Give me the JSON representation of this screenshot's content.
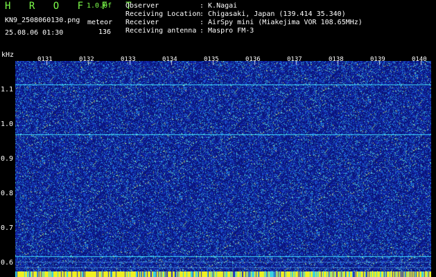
{
  "header": {
    "logo": "H R O F F T",
    "version": "1.0.0f",
    "filename": "KN9_2508060130.png",
    "datetime": "25.08.06 01:30",
    "meteor_label": "meteor",
    "meteor_count": "136"
  },
  "info": [
    {
      "key": "Observer",
      "value": ": K.Nagai"
    },
    {
      "key": "Receiving Location",
      "value": ": Chigasaki, Japan (139.414 35.340)"
    },
    {
      "key": "Receiver",
      "value": ": AirSpy mini (Miakejima VOR 108.65MHz)"
    },
    {
      "key": "Receiving antenna",
      "value": ": Maspro FM-3"
    }
  ],
  "axis": {
    "unit": "kHz",
    "y_labels": [
      "1.1",
      "1.0",
      "0.9",
      "0.8",
      "0.7",
      "0.6"
    ],
    "time_labels": [
      "0131",
      "0132",
      "0133",
      "0134",
      "0135",
      "0136",
      "0137",
      "0138",
      "0139",
      "0140"
    ]
  },
  "colors": {
    "background": "#000000",
    "spectrum_base": "#1a1aa0",
    "logo": "#7CFC4A",
    "signal_line": "#40e0ff",
    "bottom_bar": "#f0f020"
  }
}
